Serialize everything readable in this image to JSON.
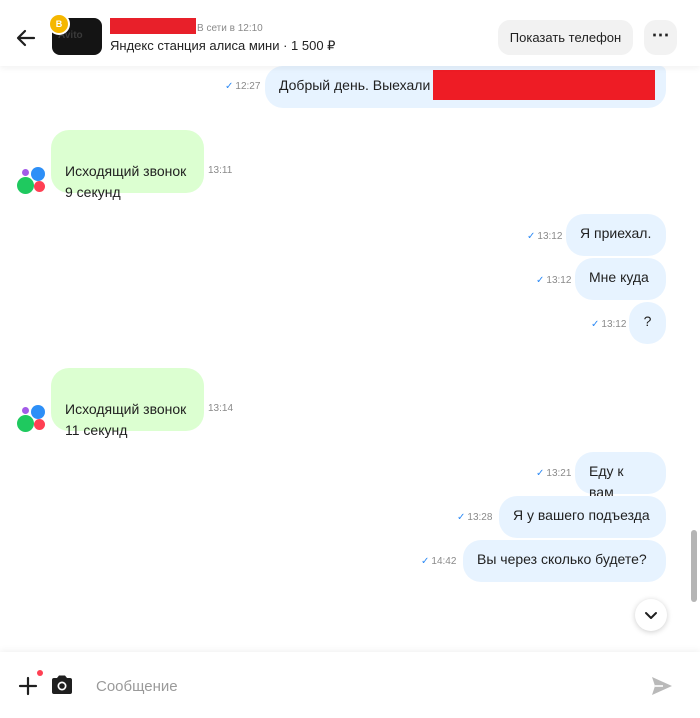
{
  "header": {
    "avatar_watermark": "Avito",
    "avatar_badge": "B",
    "status": "В сети в 12:10",
    "item_title": "Яндекс станция алиса мини · 1 500 ₽",
    "show_phone_label": "Показать телефон",
    "more_label": "⋯"
  },
  "messages": [
    {
      "text": "Добрый день. Выехали к",
      "time": "12:27",
      "check": "✓"
    },
    {
      "text": "Исходящий звонок\n9 секунд",
      "time": "13:11"
    },
    {
      "text": "Я приехал.",
      "time": "13:12",
      "check": "✓"
    },
    {
      "text": "Мне куда",
      "time": "13:12",
      "check": "✓"
    },
    {
      "text": "?",
      "time": "13:12",
      "check": "✓"
    },
    {
      "text": "Исходящий звонок\n11 секунд",
      "time": "13:14"
    },
    {
      "text": "Еду к вам",
      "time": "13:21",
      "check": "✓"
    },
    {
      "text": "Я у вашего подъезда",
      "time": "13:28",
      "check": "✓"
    },
    {
      "text": "Вы через сколько будете?",
      "time": "14:42",
      "check": "✓"
    }
  ],
  "composer": {
    "placeholder": "Сообщение"
  },
  "colors": {
    "outgoing_bubble": "#e7f3ff",
    "call_bubble": "#dcffd1",
    "check": "#2f8bf5",
    "redaction": "#ee1c25",
    "notification_dot": "#ff4053"
  },
  "icons": {
    "back": "arrow-left-icon",
    "more": "more-dots-icon",
    "scroll_down": "chevron-down-icon",
    "attach": "plus-icon",
    "camera": "camera-icon",
    "send": "send-icon"
  }
}
